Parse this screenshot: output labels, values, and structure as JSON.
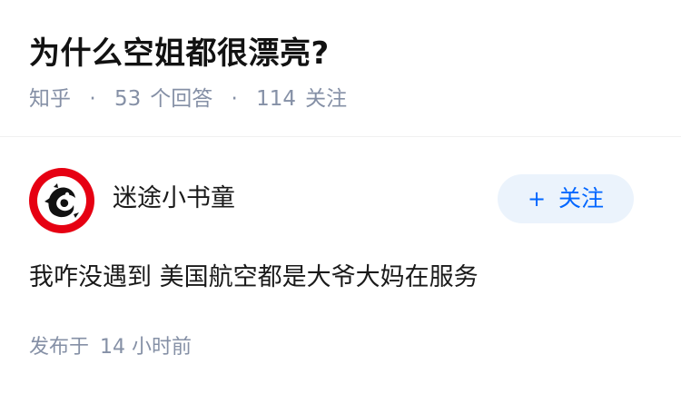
{
  "question": {
    "title": "为什么空姐都很漂亮?",
    "source": "知乎",
    "separator": "·",
    "answer_count": "53",
    "answer_label": "个回答",
    "follower_count": "114",
    "follower_label": "关注"
  },
  "answer": {
    "author_name": "迷途小书童",
    "follow_plus": "+",
    "follow_label": "关注",
    "content": "我咋没遇到 美国航空都是大爷大妈在服务",
    "published_label": "发布于",
    "published_time": "14 小时前"
  },
  "colors": {
    "accent": "#0066ff",
    "follow_bg": "#ebf3fc",
    "meta_text": "#8590a6",
    "avatar_ring": "#e60012"
  },
  "icons": {
    "avatar": "dragon-emblem-avatar"
  }
}
